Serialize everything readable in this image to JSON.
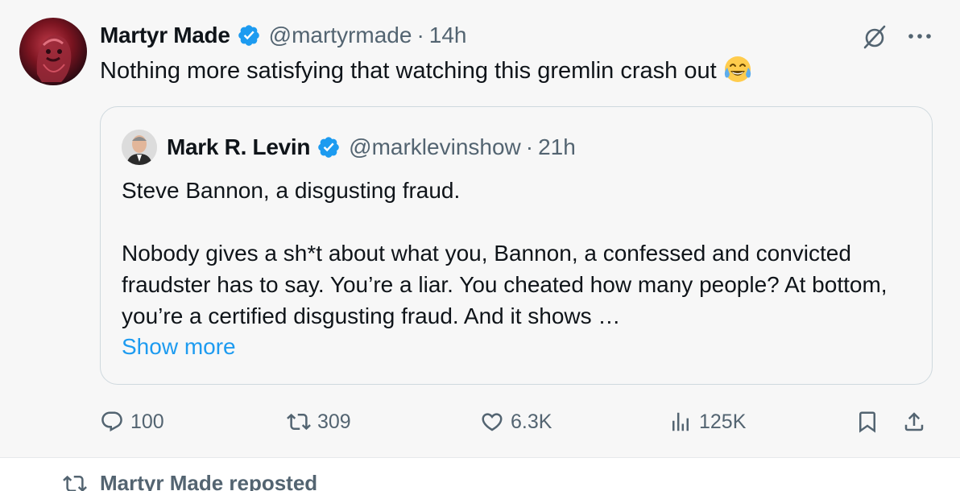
{
  "tweet": {
    "author_name": "Martyr Made",
    "author_handle": "@martyrmade",
    "separator": "·",
    "time": "14h",
    "text": "Nothing more satisfying that watching this gremlin crash out",
    "emoji_icon": "face-with-tears-of-joy-icon",
    "verified_color": "#1d9bf0"
  },
  "quote": {
    "author_name": "Mark R. Levin",
    "author_handle": "@marklevinshow",
    "separator": "·",
    "time": "21h",
    "text": "Steve Bannon, a disgusting fraud.\n\nNobody gives a sh*t about what you, Bannon, a confessed and convicted fraudster has to say. You’re a liar. You cheated how many people?  At bottom, you’re a certified disgusting fraud. And it shows …",
    "show_more": "Show more"
  },
  "actions": {
    "replies": "100",
    "reposts": "309",
    "likes": "6.3K",
    "views": "125K"
  },
  "next_item": {
    "repost_label": "Martyr Made reposted"
  },
  "colors": {
    "text_primary": "#0f1419",
    "text_secondary": "#536471",
    "link": "#1d9bf0",
    "border": "#cfd9de",
    "background": "#f7f7f7"
  }
}
